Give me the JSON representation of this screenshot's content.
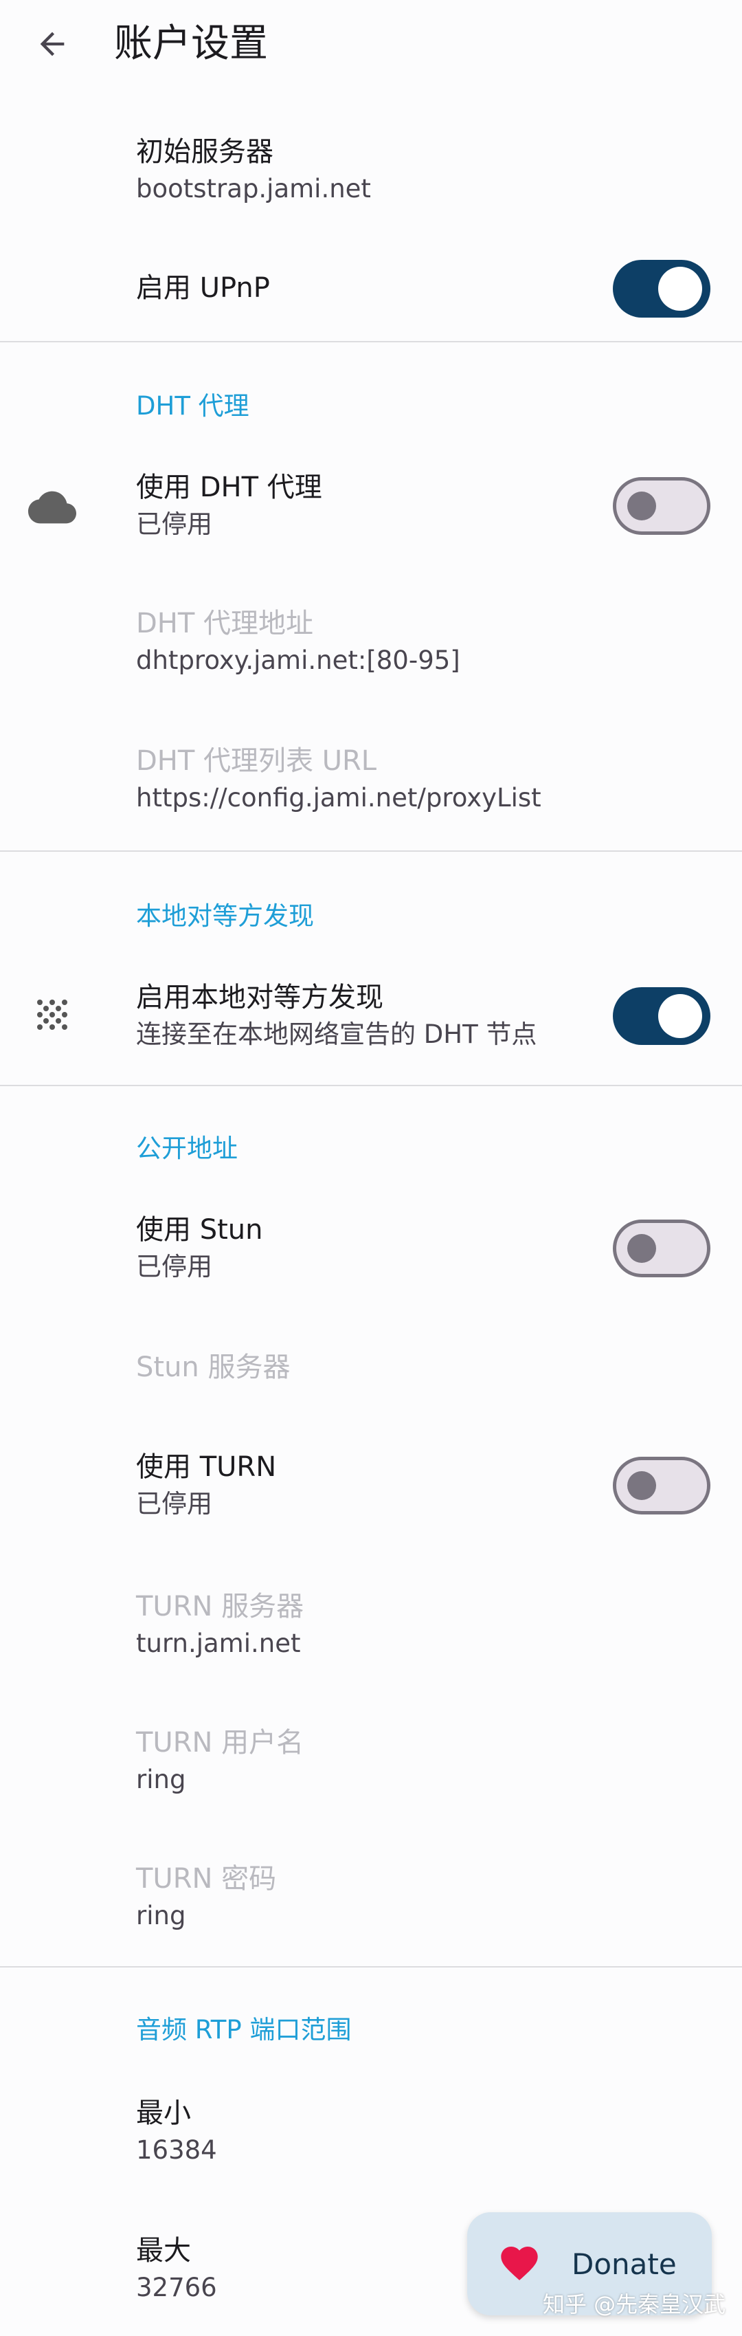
{
  "appbar": {
    "title": "账户设置"
  },
  "bootstrap": {
    "title": "初始服务器",
    "value": "bootstrap.jami.net"
  },
  "upnp": {
    "title": "启用 UPnP",
    "enabled": true
  },
  "dht_proxy": {
    "header": "DHT 代理",
    "use": {
      "title": "使用 DHT 代理",
      "summary": "已停用",
      "enabled": false
    },
    "address": {
      "title": "DHT 代理地址",
      "value": "dhtproxy.jami.net:[80-95]"
    },
    "list_url": {
      "title": "DHT 代理列表 URL",
      "value": "https://config.jami.net/proxyList"
    }
  },
  "peer_discovery": {
    "header": "本地对等方发现",
    "enable": {
      "title": "启用本地对等方发现",
      "summary": "连接至在本地网络宣告的 DHT 节点",
      "enabled": true
    }
  },
  "public_address": {
    "header": "公开地址",
    "stun": {
      "title": "使用 Stun",
      "summary": "已停用",
      "enabled": false
    },
    "stun_server": {
      "title": "Stun 服务器"
    },
    "turn": {
      "title": "使用 TURN",
      "summary": "已停用",
      "enabled": false
    },
    "turn_server": {
      "title": "TURN 服务器",
      "value": "turn.jami.net"
    },
    "turn_username": {
      "title": "TURN 用户名",
      "value": "ring"
    },
    "turn_password": {
      "title": "TURN 密码",
      "value": "ring"
    }
  },
  "rtp_ports": {
    "header": "音频 RTP 端口范围",
    "min": {
      "title": "最小",
      "value": "16384"
    },
    "max": {
      "title": "最大",
      "value": "32766"
    }
  },
  "donate": {
    "label": "Donate"
  },
  "watermark": "知乎 @先秦皇汉武",
  "icons": {
    "back": "arrow-back-icon",
    "cloud": "cloud-icon",
    "peer_discovery": "dots-grid-icon",
    "heart": "heart-icon"
  },
  "colors": {
    "accent": "#1e9ed7",
    "switch_on": "#0d3f66",
    "switch_off_track": "#e7e1e9",
    "switch_off_outline": "#7a7580",
    "donate_bg": "#d7e5f0",
    "heart": "#e8174a"
  }
}
